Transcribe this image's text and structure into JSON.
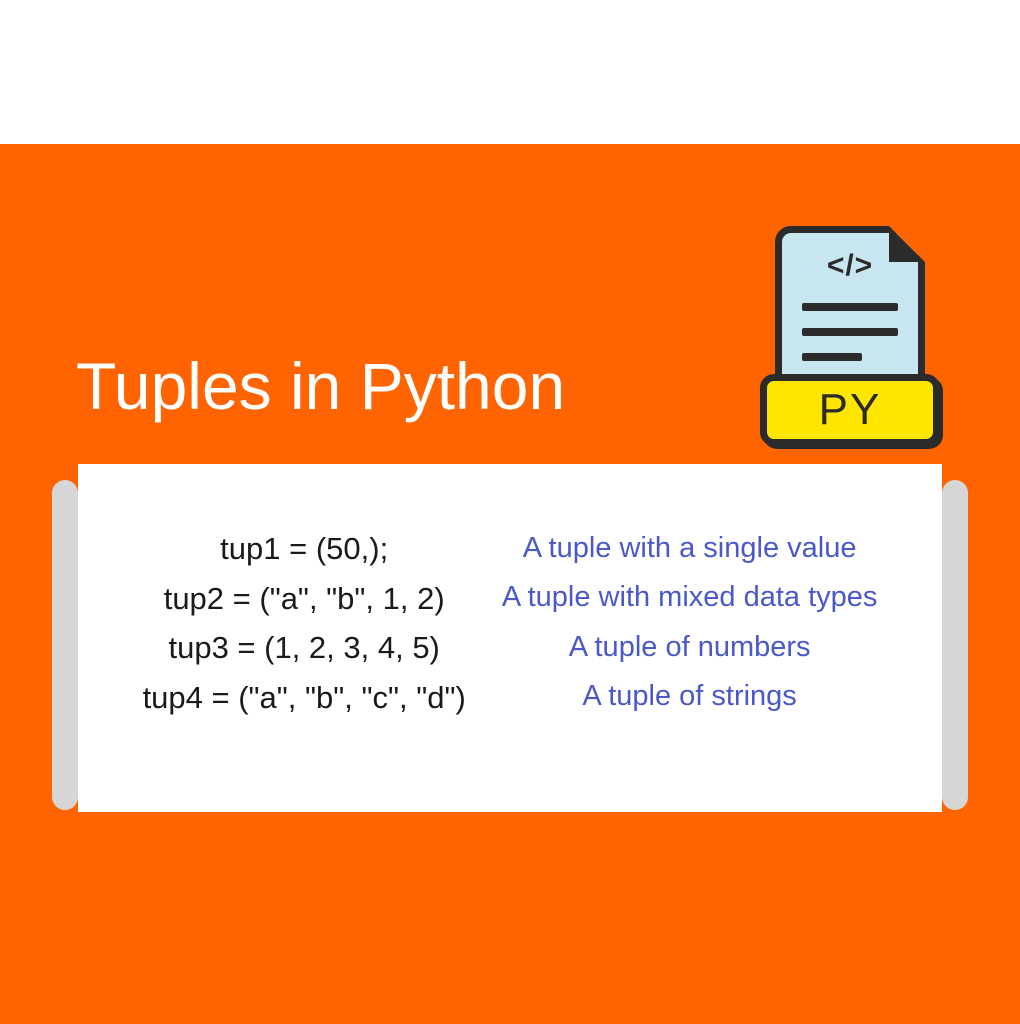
{
  "header": {
    "title": "Tuples in Python",
    "icon": {
      "code_symbol": "</>",
      "label": "PY"
    }
  },
  "examples": [
    {
      "code": "tup1 = (50,);",
      "desc": "A tuple with a single value"
    },
    {
      "code": "tup2 = (\"a\", \"b\", 1, 2)",
      "desc": "A tuple with mixed data types"
    },
    {
      "code": "tup3 = (1, 2, 3, 4, 5)",
      "desc": "A tuple of numbers"
    },
    {
      "code": "tup4 = (\"a\", \"b\", \"c\", \"d\")",
      "desc": "A tuple of strings"
    }
  ],
  "colors": {
    "accent": "#ff6400",
    "desc_text": "#4a58c9",
    "icon_bg": "#c8e6f0",
    "icon_label_bg": "#ffe600"
  }
}
